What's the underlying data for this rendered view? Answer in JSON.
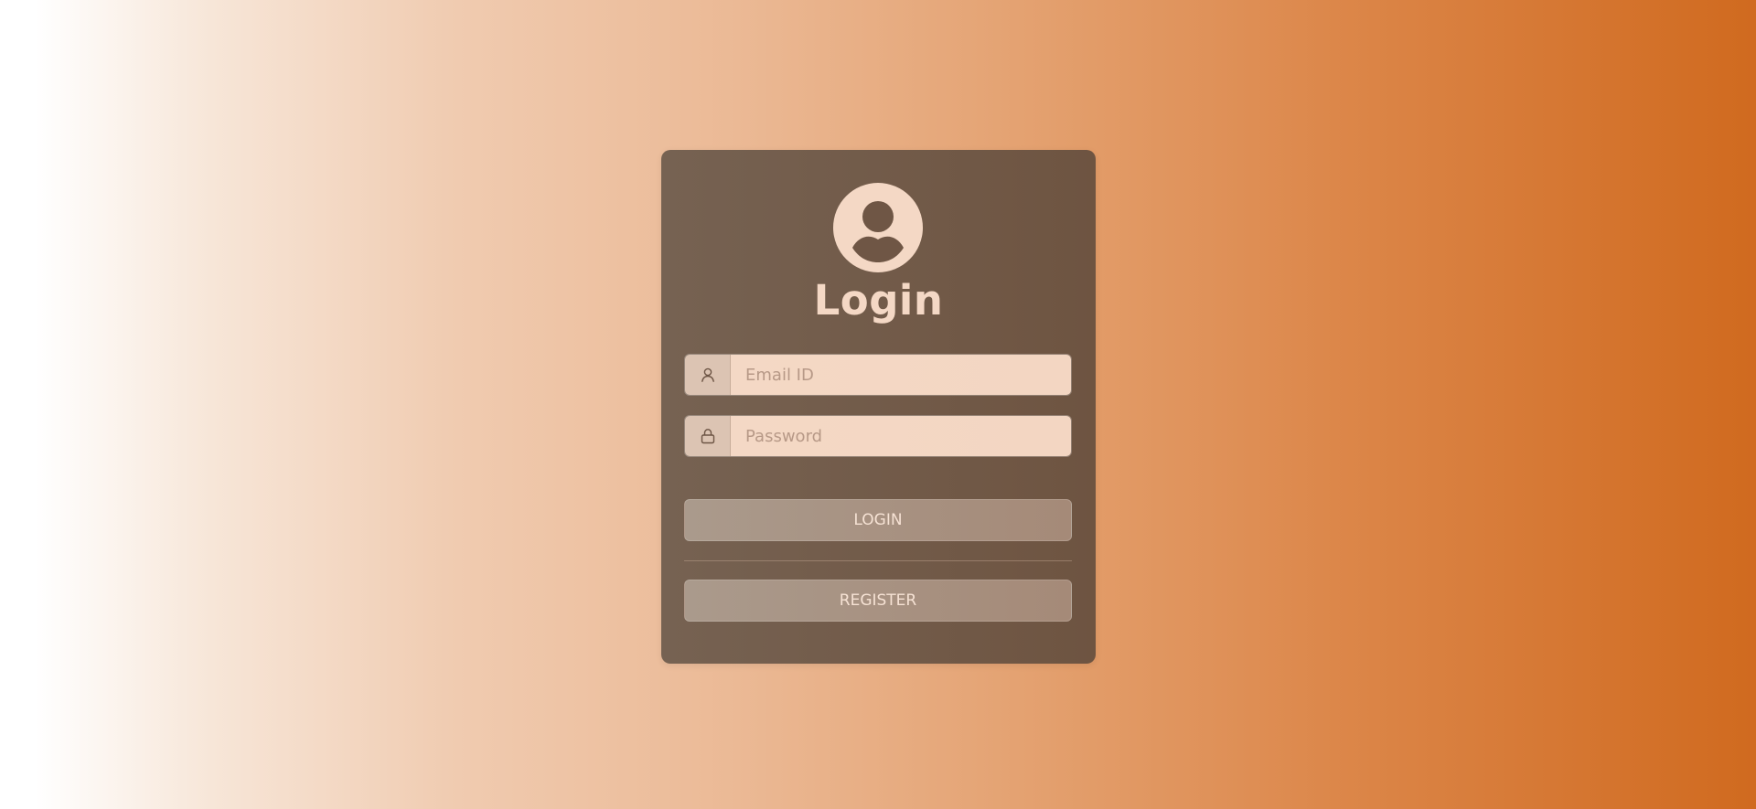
{
  "login_form": {
    "title": "Login",
    "email_field": {
      "placeholder": "Email ID",
      "value": "",
      "icon": "user-icon"
    },
    "password_field": {
      "placeholder": "Password",
      "value": "",
      "icon": "lock-icon"
    },
    "login_button_label": "LOGIN",
    "register_button_label": "REGISTER",
    "avatar_icon": "user-avatar-icon"
  },
  "colors": {
    "card_background": "#6e5441",
    "accent_text": "#f4d8c5",
    "input_background": "#f4d8c5",
    "button_background": "#aa9a8c",
    "background_gradient_end": "#d06a1f"
  }
}
